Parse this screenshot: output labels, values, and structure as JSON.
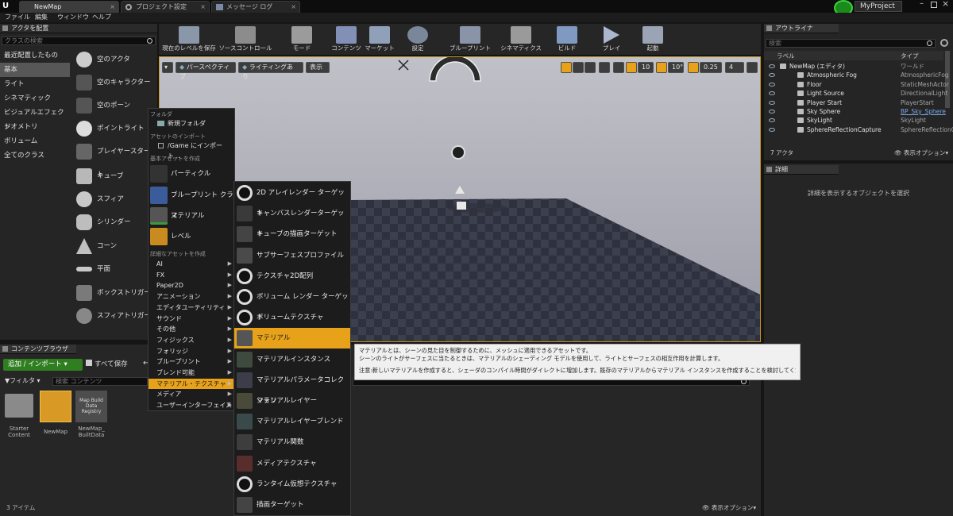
{
  "tabs": [
    {
      "label": "NewMap"
    },
    {
      "label": "プロジェクト設定"
    },
    {
      "label": "メッセージ ログ"
    }
  ],
  "project_name": "MyProject",
  "menu": [
    "ファイル",
    "編集",
    "ウィンドウ",
    "ヘルプ"
  ],
  "place_actors": {
    "title": "アクタを配置",
    "search_placeholder": "クラスの検索",
    "categories": [
      "最近配置したもの",
      "基本",
      "ライト",
      "シネマティック",
      "ビジュアルエフェクト",
      "ジオメトリ",
      "ボリューム",
      "全てのクラス"
    ],
    "items": [
      "空のアクタ",
      "空のキャラクター",
      "空のポーン",
      "ポイントライト",
      "プレイヤースタート",
      "キューブ",
      "スフィア",
      "シリンダー",
      "コーン",
      "平面",
      "ボックストリガー",
      "スフィアトリガー"
    ]
  },
  "toolbar": [
    "現在のレベルを保存",
    "ソースコントロール",
    "モード",
    "コンテンツ",
    "マーケット",
    "設定",
    "ブループリント",
    "シネマティクス",
    "ビルド",
    "プレイ",
    "起動"
  ],
  "viewport": {
    "perspective": "パースペクティブ",
    "lighting": "ライティングあり",
    "show": "表示",
    "grid_snap": "10",
    "rot_snap": "10°",
    "scale_snap": "0.25",
    "cam_speed": "4"
  },
  "context_menu": {
    "folder_label": "フォルダ",
    "new_folder": "新規フォルダ",
    "import_label": "アセットのインポート",
    "import_item": "/Game にインポート...",
    "basic_label": "基本アセットを作成",
    "basic_items": [
      "パーティクル",
      "ブループリント クラス",
      "マテリアル",
      "レベル"
    ],
    "advanced_label": "詳細なアセットを作成",
    "advanced_items": [
      "AI",
      "FX",
      "Paper2D",
      "アニメーション",
      "エディタユーティリティ",
      "サウンド",
      "その他",
      "フィジックス",
      "フォリッジ",
      "ブループリント",
      "ブレンド可能",
      "マテリアル・テクスチャ",
      "メディア",
      "ユーザーインターフェイス"
    ]
  },
  "submenu": [
    "2D アレイレンダー ターゲット",
    "キャンバスレンダーターゲット",
    "キューブの描画ターゲット",
    "サブサーフェスプロファイル",
    "テクスチャ2D配列",
    "ボリューム レンダー ターゲット",
    "ボリュームテクスチャ",
    "マテリアル",
    "マテリアルインスタンス",
    "マテリアルパラメータコレクション",
    "マテリアルレイヤー",
    "マテリアルレイヤーブレンド",
    "マテリアル関数",
    "メディアテクスチャ",
    "ランタイム仮想テクスチャ",
    "描画ターゲット"
  ],
  "tooltip": {
    "line1": "マテリアルとは、シーンの見た目を制御するために、メッシュに適用できるアセットです。",
    "line2": "シーンのライトがサーフェスに当たるときは、マテリアルのシェーディング モデルを使用して、ライトとサーフェスの相互作用を計算します。",
    "line3": "注意:新しいマテリアルを作成すると、シェーダのコンパイル時間がダイレクトに増加します。既存のマテリアルからマテリアル インスタンスを作成することを検討してください。"
  },
  "outliner": {
    "title": "アウトライナ",
    "search_placeholder": "検索",
    "col_label": "ラベル",
    "col_type": "タイプ",
    "rows": [
      {
        "name": "NewMap (エディタ)",
        "type": "ワールド"
      },
      {
        "name": "Atmospheric Fog",
        "type": "AtmosphericFog"
      },
      {
        "name": "Floor",
        "type": "StaticMeshActor"
      },
      {
        "name": "Light Source",
        "type": "DirectionalLight"
      },
      {
        "name": "Player Start",
        "type": "PlayerStart"
      },
      {
        "name": "Sky Sphere",
        "type": "BP_Sky_Sphere"
      },
      {
        "name": "SkyLight",
        "type": "SkyLight"
      },
      {
        "name": "SphereReflectionCapture",
        "type": "SphereReflectionC"
      }
    ],
    "count": "7 アクタ",
    "view_options": "表示オプション"
  },
  "details": {
    "title": "詳細",
    "empty_text": "詳細を表示するオブジェクトを選択"
  },
  "content_browser": {
    "title": "コンテンツブラウザ",
    "add_import": "追加 / インポート",
    "save_all": "すべて保存",
    "filter": "フィルタ",
    "search_placeholder": "検索 コンテンツ",
    "items": [
      {
        "name": "Starter Content"
      },
      {
        "name": "NewMap"
      },
      {
        "name": "NewMap_ BuiltData",
        "thumb": "Map Build Data Registry"
      }
    ],
    "item_count": "3 アイテム",
    "view_options": "表示オプション"
  }
}
